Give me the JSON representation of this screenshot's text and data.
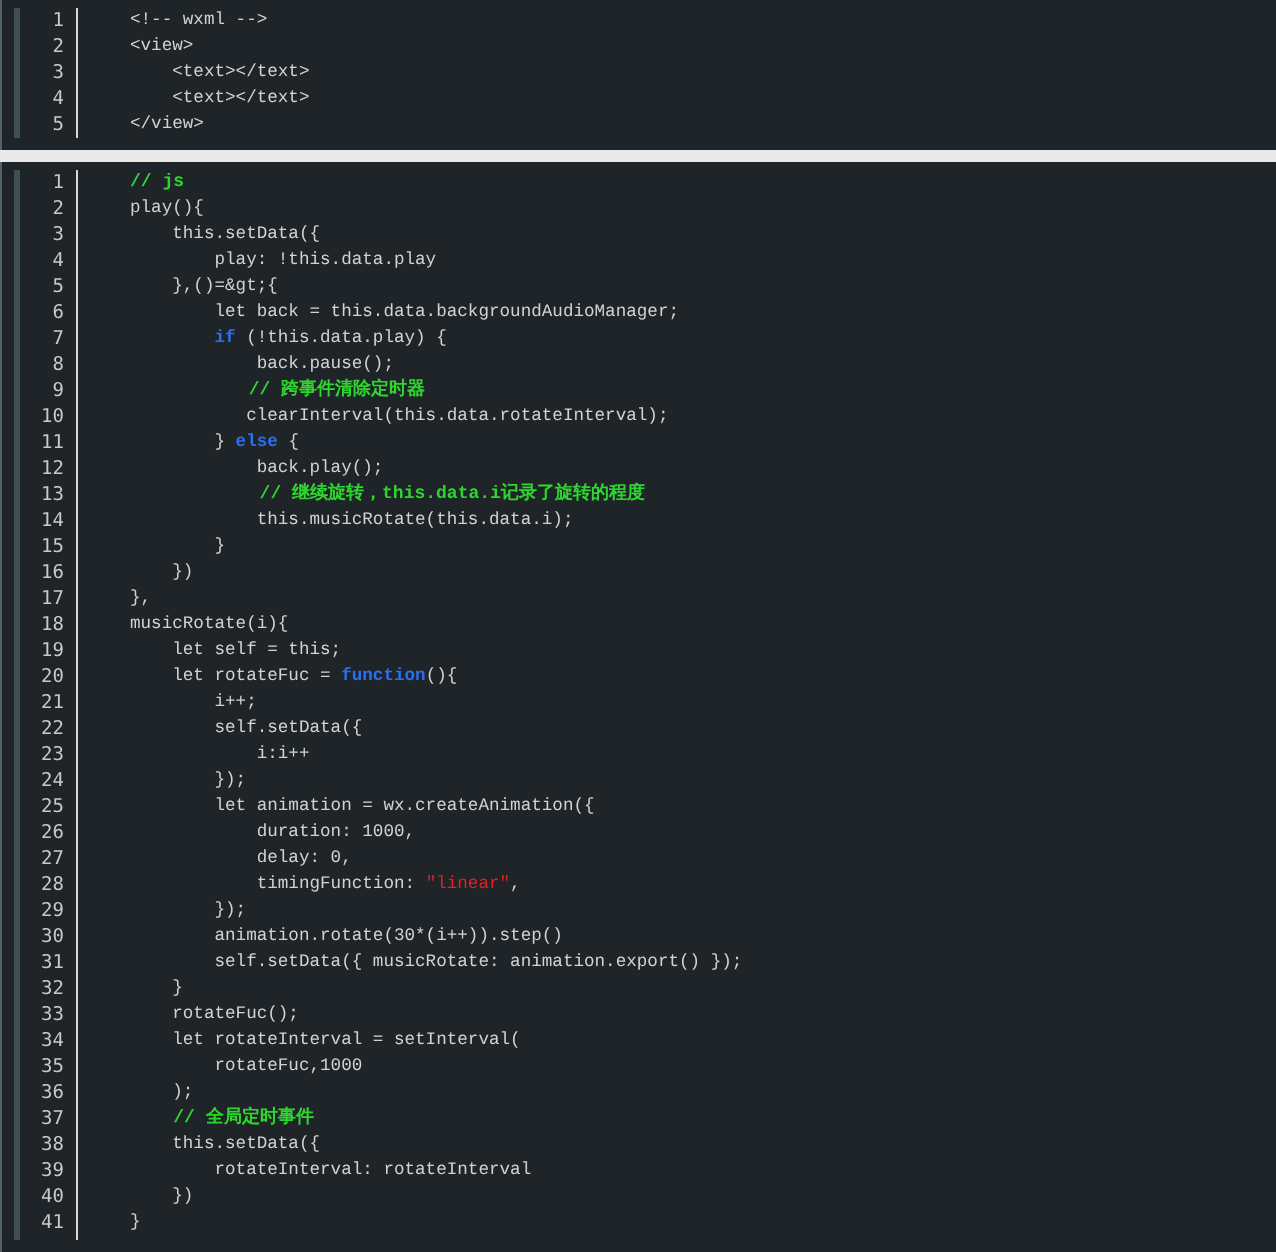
{
  "code_blocks": [
    {
      "lines": [
        {
          "number": "1",
          "tokens": [
            {
              "kind": "plain",
              "text": "<!-- wxml -->"
            }
          ]
        },
        {
          "number": "2",
          "tokens": [
            {
              "kind": "plain",
              "text": "<view>"
            }
          ]
        },
        {
          "number": "3",
          "tokens": [
            {
              "kind": "plain",
              "text": "    <text></text>"
            }
          ]
        },
        {
          "number": "4",
          "tokens": [
            {
              "kind": "plain",
              "text": "    <text></text>"
            }
          ]
        },
        {
          "number": "5",
          "tokens": [
            {
              "kind": "plain",
              "text": "</view>"
            }
          ]
        }
      ]
    },
    {
      "lines": [
        {
          "number": "1",
          "tokens": [
            {
              "kind": "comment",
              "text": "// js"
            }
          ]
        },
        {
          "number": "2",
          "tokens": [
            {
              "kind": "plain",
              "text": "play(){"
            }
          ]
        },
        {
          "number": "3",
          "tokens": [
            {
              "kind": "plain",
              "text": "    this.setData({"
            }
          ]
        },
        {
          "number": "4",
          "tokens": [
            {
              "kind": "plain",
              "text": "        play: !this.data.play"
            }
          ]
        },
        {
          "number": "5",
          "tokens": [
            {
              "kind": "plain",
              "text": "    },()=&gt;{"
            }
          ]
        },
        {
          "number": "6",
          "tokens": [
            {
              "kind": "plain",
              "text": "        let back = this.data.backgroundAudioManager;"
            }
          ]
        },
        {
          "number": "7",
          "tokens": [
            {
              "kind": "keyword",
              "text": "        if"
            },
            {
              "kind": "plain",
              "text": " (!this.data.play) {"
            }
          ]
        },
        {
          "number": "8",
          "tokens": [
            {
              "kind": "plain",
              "text": "            back.pause();"
            }
          ]
        },
        {
          "number": "9",
          "tokens": [
            {
              "kind": "comment",
              "text": "           // 跨事件清除定时器"
            }
          ]
        },
        {
          "number": "10",
          "tokens": [
            {
              "kind": "plain",
              "text": "           clearInterval(this.data.rotateInterval);"
            }
          ]
        },
        {
          "number": "11",
          "tokens": [
            {
              "kind": "plain",
              "text": "        } "
            },
            {
              "kind": "keyword",
              "text": "else"
            },
            {
              "kind": "plain",
              "text": " {"
            }
          ]
        },
        {
          "number": "12",
          "tokens": [
            {
              "kind": "plain",
              "text": "            back.play();"
            }
          ]
        },
        {
          "number": "13",
          "tokens": [
            {
              "kind": "comment",
              "text": "            // 继续旋转，this.data.i记录了旋转的程度"
            }
          ]
        },
        {
          "number": "14",
          "tokens": [
            {
              "kind": "plain",
              "text": "            this.musicRotate(this.data.i);"
            }
          ]
        },
        {
          "number": "15",
          "tokens": [
            {
              "kind": "plain",
              "text": "        }"
            }
          ]
        },
        {
          "number": "16",
          "tokens": [
            {
              "kind": "plain",
              "text": "    })"
            }
          ]
        },
        {
          "number": "17",
          "tokens": [
            {
              "kind": "plain",
              "text": "},"
            }
          ]
        },
        {
          "number": "18",
          "tokens": [
            {
              "kind": "plain",
              "text": "musicRotate(i){"
            }
          ]
        },
        {
          "number": "19",
          "tokens": [
            {
              "kind": "plain",
              "text": "    let self = this;"
            }
          ]
        },
        {
          "number": "20",
          "tokens": [
            {
              "kind": "plain",
              "text": "    let rotateFuc = "
            },
            {
              "kind": "keyword",
              "text": "function"
            },
            {
              "kind": "plain",
              "text": "(){"
            }
          ]
        },
        {
          "number": "21",
          "tokens": [
            {
              "kind": "plain",
              "text": "        i++;"
            }
          ]
        },
        {
          "number": "22",
          "tokens": [
            {
              "kind": "plain",
              "text": "        self.setData({"
            }
          ]
        },
        {
          "number": "23",
          "tokens": [
            {
              "kind": "plain",
              "text": "            i:i++"
            }
          ]
        },
        {
          "number": "24",
          "tokens": [
            {
              "kind": "plain",
              "text": "        });"
            }
          ]
        },
        {
          "number": "25",
          "tokens": [
            {
              "kind": "plain",
              "text": "        let animation = wx.createAnimation({"
            }
          ]
        },
        {
          "number": "26",
          "tokens": [
            {
              "kind": "plain",
              "text": "            duration: 1000,"
            }
          ]
        },
        {
          "number": "27",
          "tokens": [
            {
              "kind": "plain",
              "text": "            delay: 0,"
            }
          ]
        },
        {
          "number": "28",
          "tokens": [
            {
              "kind": "plain",
              "text": "            timingFunction: "
            },
            {
              "kind": "string",
              "text": "\"linear\""
            },
            {
              "kind": "plain",
              "text": ","
            }
          ]
        },
        {
          "number": "29",
          "tokens": [
            {
              "kind": "plain",
              "text": "        });"
            }
          ]
        },
        {
          "number": "30",
          "tokens": [
            {
              "kind": "plain",
              "text": "        animation.rotate(30*(i++)).step()"
            }
          ]
        },
        {
          "number": "31",
          "tokens": [
            {
              "kind": "plain",
              "text": "        self.setData({ musicRotate: animation.export() });"
            }
          ]
        },
        {
          "number": "32",
          "tokens": [
            {
              "kind": "plain",
              "text": "    }"
            }
          ]
        },
        {
          "number": "33",
          "tokens": [
            {
              "kind": "plain",
              "text": "    rotateFuc();"
            }
          ]
        },
        {
          "number": "34",
          "tokens": [
            {
              "kind": "plain",
              "text": "    let rotateInterval = setInterval("
            }
          ]
        },
        {
          "number": "35",
          "tokens": [
            {
              "kind": "plain",
              "text": "        rotateFuc,1000"
            }
          ]
        },
        {
          "number": "36",
          "tokens": [
            {
              "kind": "plain",
              "text": "    );"
            }
          ]
        },
        {
          "number": "37",
          "tokens": [
            {
              "kind": "comment",
              "text": "    // 全局定时事件"
            }
          ]
        },
        {
          "number": "38",
          "tokens": [
            {
              "kind": "plain",
              "text": "    this.setData({"
            }
          ]
        },
        {
          "number": "39",
          "tokens": [
            {
              "kind": "plain",
              "text": "        rotateInterval: rotateInterval"
            }
          ]
        },
        {
          "number": "40",
          "tokens": [
            {
              "kind": "plain",
              "text": "    })"
            }
          ]
        },
        {
          "number": "41",
          "tokens": [
            {
              "kind": "plain",
              "text": "}"
            }
          ]
        }
      ]
    }
  ]
}
